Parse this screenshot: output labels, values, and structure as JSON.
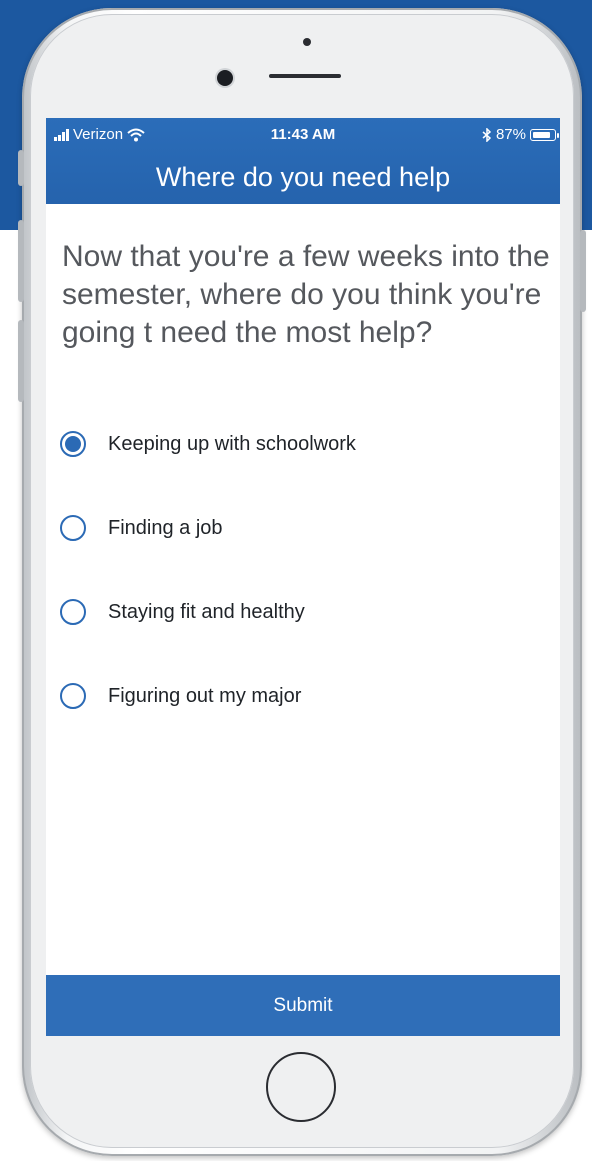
{
  "status_bar": {
    "carrier": "Verizon",
    "time": "11:43 AM",
    "battery": "87%",
    "battery_level": 0.87
  },
  "header": {
    "title": "Where do you need help"
  },
  "question": "Now that you're a few weeks into the semester, where do you think you're going t need the most help?",
  "options": [
    {
      "label": "Keeping up with schoolwork",
      "selected": true
    },
    {
      "label": "Finding a job",
      "selected": false
    },
    {
      "label": "Staying fit and healthy",
      "selected": false
    },
    {
      "label": "Figuring out my major",
      "selected": false
    }
  ],
  "submit_label": "Submit",
  "colors": {
    "accent": "#2b6ab5",
    "background_band": "#1c58a0"
  },
  "icons": [
    "signal-icon",
    "wifi-icon",
    "bluetooth-icon",
    "battery-icon",
    "radio-icon",
    "camera-icon",
    "home-button-icon"
  ]
}
